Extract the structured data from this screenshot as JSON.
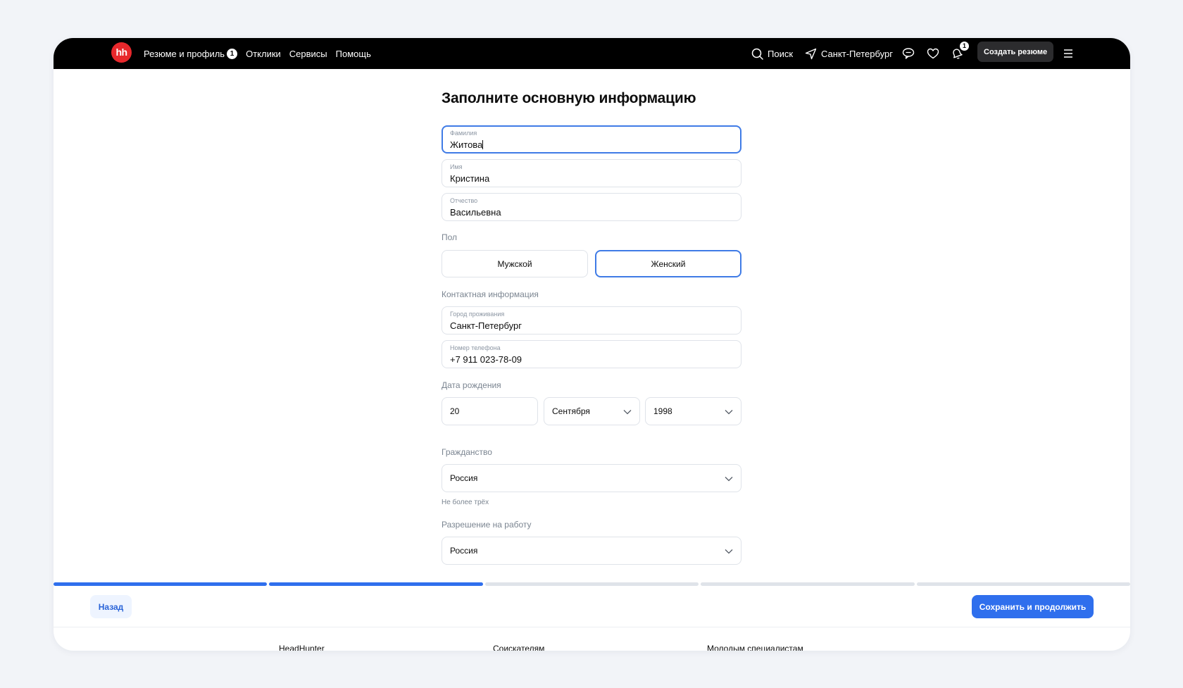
{
  "header": {
    "logo_text": "hh",
    "nav": [
      {
        "label": "Резюме и профиль",
        "badge": "1"
      },
      {
        "label": "Отклики"
      },
      {
        "label": "Сервисы"
      },
      {
        "label": "Помощь"
      }
    ],
    "search_label": "Поиск",
    "location_label": "Санкт-Петербург",
    "notifications_badge": "1",
    "create_resume_label": "Создать резюме"
  },
  "form": {
    "title": "Заполните основную информацию",
    "last_name": {
      "label": "Фамилия",
      "value": "Житова"
    },
    "first_name": {
      "label": "Имя",
      "value": "Кристина"
    },
    "middle_name": {
      "label": "Отчество",
      "value": "Васильевна"
    },
    "gender": {
      "label": "Пол",
      "options": [
        "Мужской",
        "Женский"
      ],
      "selected": "Женский"
    },
    "contact_section_label": "Контактная информация",
    "city": {
      "label": "Город проживания",
      "value": "Санкт-Петербург"
    },
    "phone": {
      "label": "Номер телефона",
      "value": "+7 911 023-78-09"
    },
    "birth_date": {
      "label": "Дата рождения",
      "day": "20",
      "month": "Сентября",
      "year": "1998"
    },
    "citizenship": {
      "label": "Гражданство",
      "value": "Россия",
      "hint": "Не более трёх"
    },
    "work_permit": {
      "label": "Разрешение на работу",
      "value": "Россия"
    }
  },
  "progress": {
    "total_steps": 5,
    "completed_steps": 2,
    "active_color": "#2f6fed",
    "inactive_color": "#dfe3e9"
  },
  "actions": {
    "back_label": "Назад",
    "save_label": "Сохранить и продолжить"
  },
  "footer": {
    "columns": [
      "HeadHunter",
      "Соискателям",
      "Молодым специалистам"
    ]
  }
}
